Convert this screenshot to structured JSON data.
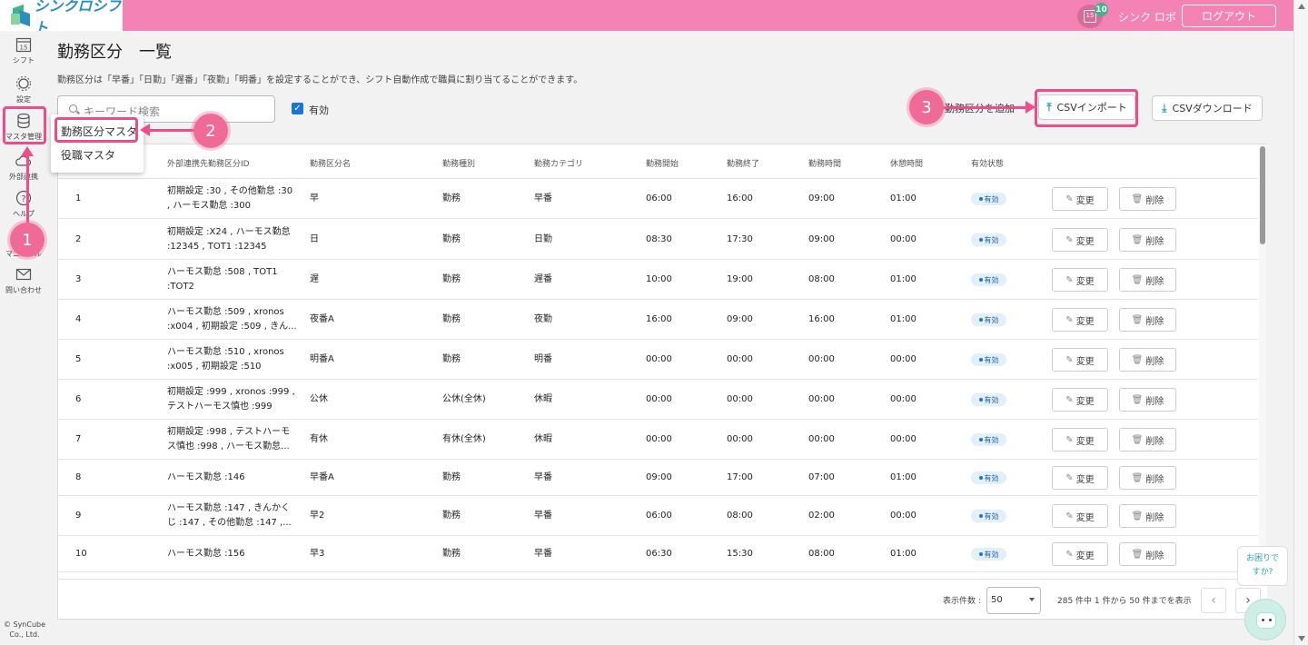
{
  "header": {
    "logo_text": "シンクロシフト",
    "calendar_day": "15",
    "badge_count": "10",
    "user_name": "シンク ロボ",
    "logout_label": "ログアウト"
  },
  "sidebar": {
    "items": [
      {
        "label": "シフト",
        "icon": "calendar-icon",
        "day": "15"
      },
      {
        "label": "設定",
        "icon": "gear-icon"
      },
      {
        "label": "マスタ管理",
        "icon": "database-icon"
      },
      {
        "label": "外部連携",
        "icon": "cloud-icon"
      },
      {
        "label": "ヘルプ",
        "icon": "question-icon"
      },
      {
        "label": "マニュアル",
        "icon": "book-icon"
      },
      {
        "label": "問い合わせ",
        "icon": "mail-icon"
      }
    ],
    "copyright": "© SynCube Co., Ltd."
  },
  "page": {
    "title": "勤務区分　一覧",
    "description": "勤務区分は「早番」「日勤」「遅番」「夜勤」「明番」を設定することができ、シフト自動作成で職員に割り当てることができます。",
    "search_placeholder": "キーワード検索",
    "filter_label": "有効",
    "buttons": {
      "add": "勤務区分を追加",
      "csv_import": "CSVインポート",
      "csv_download": "CSVダウンロード"
    }
  },
  "menu": {
    "items": [
      "勤務区分マスタ",
      "役職マスタ"
    ]
  },
  "callouts": [
    "1",
    "2",
    "3"
  ],
  "table": {
    "headers": [
      "外部連携先勤務区分ID",
      "勤務区分名",
      "勤務種別",
      "勤務カテゴリ",
      "勤務開始",
      "勤務終了",
      "勤務時間",
      "休憩時間",
      "有効状態"
    ],
    "edit_label": "変更",
    "delete_label": "削除",
    "rows": [
      {
        "no": "1",
        "ext_line1": "初期設定 :30 , その他勤怠 :30",
        "ext_line2": ", ハーモス勤怠 :300",
        "name": "早",
        "type": "勤務",
        "category": "早番",
        "start": "06:00",
        "end": "16:00",
        "hours": "09:00",
        "break": "01:00",
        "status": "有効"
      },
      {
        "no": "2",
        "ext_line1": "初期設定 :X24 , ハーモス勤怠",
        "ext_line2": ":12345 , TOT1 :12345",
        "name": "日",
        "type": "勤務",
        "category": "日勤",
        "start": "08:30",
        "end": "17:30",
        "hours": "09:00",
        "break": "00:00",
        "status": "有効"
      },
      {
        "no": "3",
        "ext_line1": "ハーモス勤怠 :508 , TOT1",
        "ext_line2": ":TOT2",
        "name": "遅",
        "type": "勤務",
        "category": "遅番",
        "start": "10:00",
        "end": "19:00",
        "hours": "08:00",
        "break": "01:00",
        "status": "有効"
      },
      {
        "no": "4",
        "ext_line1": "ハーモス勤怠 :509 , xronos",
        "ext_line2": ":x004 , 初期設定 :509 , きん...",
        "name": "夜番A",
        "type": "勤務",
        "category": "夜勤",
        "start": "16:00",
        "end": "09:00",
        "hours": "16:00",
        "break": "01:00",
        "status": "有効"
      },
      {
        "no": "5",
        "ext_line1": "ハーモス勤怠 :510 , xronos",
        "ext_line2": ":x005 , 初期設定 :510",
        "name": "明番A",
        "type": "勤務",
        "category": "明番",
        "start": "00:00",
        "end": "00:00",
        "hours": "00:00",
        "break": "00:00",
        "status": "有効"
      },
      {
        "no": "6",
        "ext_line1": "初期設定 :999 , xronos :999 ,",
        "ext_line2": "テストハーモス慎也 :999",
        "name": "公休",
        "type": "公休(全休)",
        "category": "休暇",
        "start": "00:00",
        "end": "00:00",
        "hours": "00:00",
        "break": "00:00",
        "status": "有効"
      },
      {
        "no": "7",
        "ext_line1": "初期設定 :998 , テストハーモ",
        "ext_line2": "ス慎也 :998 , ハーモス勤怠...",
        "name": "有休",
        "type": "有休(全休)",
        "category": "休暇",
        "start": "00:00",
        "end": "00:00",
        "hours": "00:00",
        "break": "00:00",
        "status": "有効"
      },
      {
        "no": "8",
        "ext_line1": "ハーモス勤怠 :146",
        "ext_line2": "",
        "name": "早番A",
        "type": "勤務",
        "category": "早番",
        "start": "09:00",
        "end": "17:00",
        "hours": "07:00",
        "break": "01:00",
        "status": "有効"
      },
      {
        "no": "9",
        "ext_line1": "ハーモス勤怠 :147 , きんかく",
        "ext_line2": "じ :147 , その他勤怠 :147 ,...",
        "name": "早2",
        "type": "勤務",
        "category": "早番",
        "start": "06:00",
        "end": "08:00",
        "hours": "02:00",
        "break": "00:00",
        "status": "有効"
      },
      {
        "no": "10",
        "ext_line1": "ハーモス勤怠 :156",
        "ext_line2": "",
        "name": "早3",
        "type": "勤務",
        "category": "早番",
        "start": "06:30",
        "end": "15:30",
        "hours": "08:00",
        "break": "01:00",
        "status": "有効"
      }
    ]
  },
  "pagination": {
    "per_page_label": "表示件数 :",
    "per_page_value": "50",
    "info": "285 件中 1 件から 50 件までを表示"
  },
  "help": {
    "line1": "お困りで",
    "line2": "すか?"
  }
}
